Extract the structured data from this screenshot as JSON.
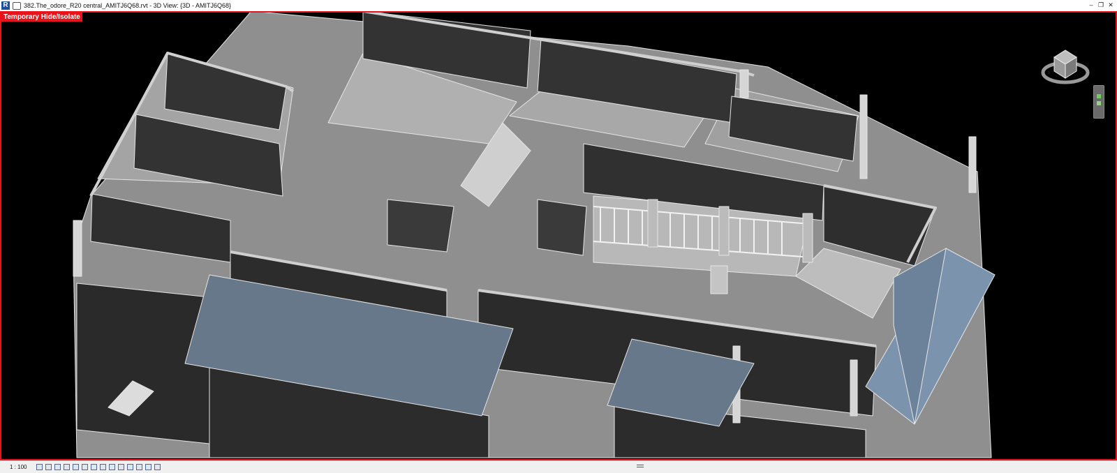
{
  "window": {
    "title": "382.The_odore_R20 central_AMITJ6Q68.rvt - 3D View: {3D - AMITJ6Q68}",
    "app_icon_letter": "R",
    "controls": [
      "–",
      "❐",
      "✕"
    ]
  },
  "view": {
    "mode_label": "Temporary Hide/Isolate",
    "mode_color": "#e8141b",
    "background": "#000000"
  },
  "view_control_bar": {
    "scale": "1 : 100",
    "icons": [
      "detail-level-icon",
      "visual-style-icon",
      "sun-path-icon",
      "shadows-icon",
      "render-icon",
      "crop-view-icon",
      "show-crop-icon",
      "unlock-3d-icon",
      "temporary-hide-icon",
      "reveal-hidden-icon",
      "temp-view-props-icon",
      "analytical-model-icon",
      "highlight-displacement-icon",
      "constraints-icon"
    ]
  },
  "colors": {
    "wall_face": "#3a3a3a",
    "floor": "#9a9a9a",
    "wall_top": "#c8c8c8",
    "roof": "#6a7a8a",
    "edge": "#e6e6e6"
  }
}
